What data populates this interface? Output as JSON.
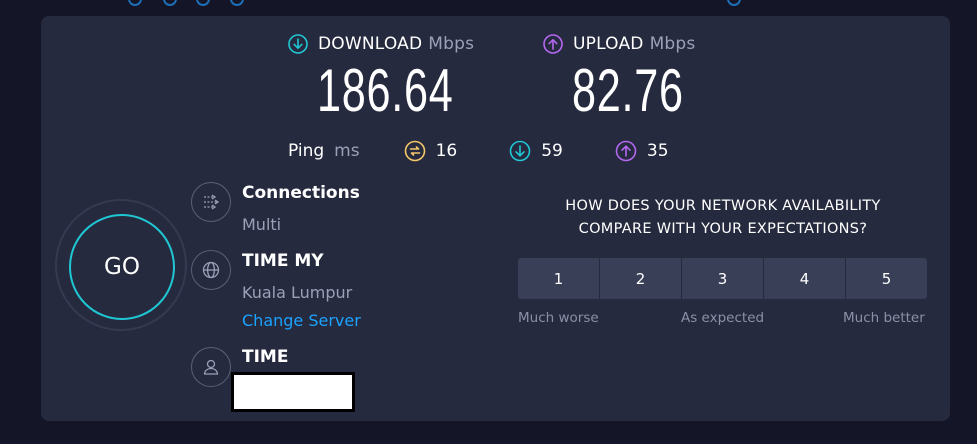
{
  "download": {
    "label": "DOWNLOAD",
    "unit": "Mbps",
    "value": "186.64",
    "color": "#1fc7d4"
  },
  "upload": {
    "label": "UPLOAD",
    "unit": "Mbps",
    "value": "82.76",
    "color": "#b468f0"
  },
  "ping": {
    "label": "Ping",
    "unit": "ms",
    "idle": "16",
    "download": "59",
    "upload": "35",
    "idle_color": "#f4c86a"
  },
  "go_button": {
    "label": "GO",
    "ring_color": "#1fc7d4"
  },
  "connections": {
    "title": "Connections",
    "value": "Multi",
    "icon": "connections-icon"
  },
  "server": {
    "title": "TIME MY",
    "location": "Kuala Lumpur",
    "change_link": "Change Server",
    "icon": "globe-icon"
  },
  "provider": {
    "title": "TIME",
    "icon": "user-icon"
  },
  "survey": {
    "question_line1": "HOW DOES YOUR NETWORK AVAILABILITY",
    "question_line2": "COMPARE WITH YOUR EXPECTATIONS?",
    "options": [
      "1",
      "2",
      "3",
      "4",
      "5"
    ],
    "scale_low": "Much worse",
    "scale_mid": "As expected",
    "scale_high": "Much better"
  },
  "link_color": "#1aa3ff"
}
